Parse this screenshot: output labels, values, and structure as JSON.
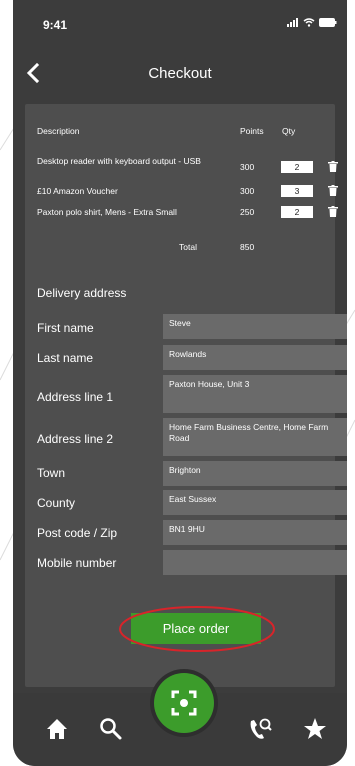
{
  "status_bar": {
    "time": "9:41"
  },
  "header": {
    "title": "Checkout"
  },
  "items_table": {
    "headers": {
      "description": "Description",
      "points": "Points",
      "qty": "Qty"
    },
    "rows": [
      {
        "description": "Desktop reader with keyboard output - USB",
        "points": "300",
        "qty": "2"
      },
      {
        "description": "£10 Amazon Voucher",
        "points": "300",
        "qty": "3"
      },
      {
        "description": "Paxton polo shirt, Mens - Extra Small",
        "points": "250",
        "qty": "2"
      }
    ],
    "total_label": "Total",
    "total_value": "850"
  },
  "delivery": {
    "title": "Delivery address",
    "fields": {
      "first_name": {
        "label": "First name",
        "value": "Steve"
      },
      "last_name": {
        "label": "Last name",
        "value": "Rowlands"
      },
      "address1": {
        "label": "Address line 1",
        "value": "Paxton House, Unit 3"
      },
      "address2": {
        "label": "Address line 2",
        "value": "Home Farm Business Centre, Home Farm Road"
      },
      "town": {
        "label": "Town",
        "value": "Brighton"
      },
      "county": {
        "label": "County",
        "value": "East Sussex"
      },
      "postcode": {
        "label": "Post code / Zip",
        "value": "BN1 9HU"
      },
      "mobile": {
        "label": "Mobile number",
        "value": ""
      }
    }
  },
  "actions": {
    "place_order": "Place order"
  },
  "tab_bar": {
    "tabs": [
      "home-icon",
      "search-icon",
      "scan-icon",
      "call-icon",
      "star-icon"
    ],
    "active": "scan-icon"
  },
  "colors": {
    "accent_green": "#3c9c2b",
    "highlight_red": "#d8242a",
    "phone_bg": "#3c3c3c",
    "card_bg": "#4e4e4e",
    "field_bg": "#6a6a6a"
  }
}
